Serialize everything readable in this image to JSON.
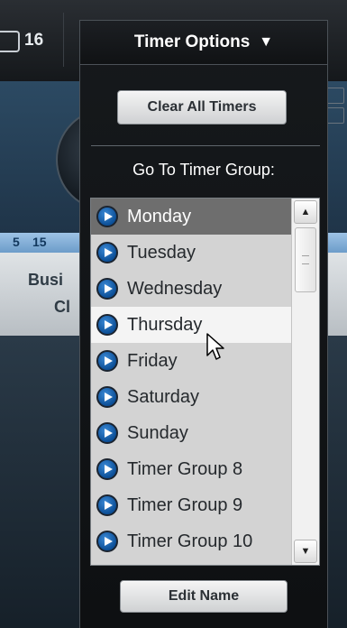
{
  "background": {
    "counter": "16",
    "ruler_numbers": [
      "5",
      "15"
    ],
    "card_title": "Busi",
    "card_subtitle": "Cl"
  },
  "dropdown": {
    "title": "Timer Options",
    "title_arrow": "▼",
    "clear_button": "Clear All Timers",
    "goto_label": "Go To Timer Group:",
    "edit_button": "Edit Name",
    "selected_item": "Monday",
    "hovered_item": "Thursday",
    "items": [
      "Monday",
      "Tuesday",
      "Wednesday",
      "Thursday",
      "Friday",
      "Saturday",
      "Sunday",
      "Timer Group 8",
      "Timer Group 9",
      "Timer Group 10"
    ],
    "scroll_up_icon": "▲",
    "scroll_down_icon": "▼"
  },
  "colors": {
    "panel_bg": "#121417",
    "list_bg": "#d3d3d3",
    "selected_bg": "#6e6e6e",
    "hover_bg": "#f4f4f4",
    "play_icon": "#1f6fc0"
  },
  "icons": {
    "list_item_icon": "play-circle-icon",
    "cursor": "mouse-pointer-icon",
    "dropdown_arrow": "triangle-down-icon"
  }
}
